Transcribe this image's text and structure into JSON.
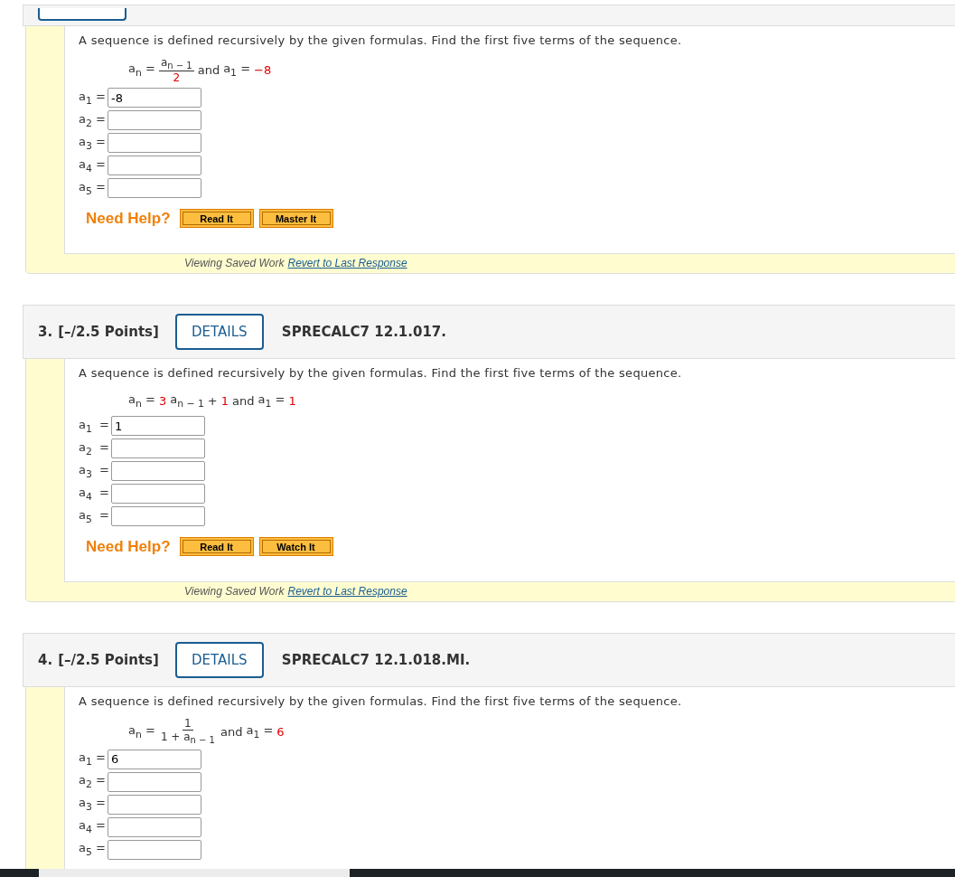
{
  "problems": [
    {
      "question": "A sequence is defined recursively by the given formulas. Find the first five terms of the sequence.",
      "formula": [
        {
          "text": "a$_{n}$ =",
          "red": false
        },
        {
          "kind": "fraction",
          "numerator": [
            {
              "text": "a$_{n − 1}$",
              "red": false
            }
          ],
          "denominator": [
            {
              "text": "2",
              "red": true
            }
          ]
        },
        {
          "text": "and",
          "red": false
        },
        {
          "text": "a$_{1}$ =",
          "red": false
        },
        {
          "text": "−8",
          "red": true
        }
      ],
      "answers": [
        {
          "label": "a$_{1}$ =",
          "value": "-8"
        },
        {
          "label": "a$_{2}$ ="
        },
        {
          "label": "a$_{3}$ ="
        },
        {
          "label": "a$_{4}$ ="
        },
        {
          "label": "a$_{5}$ ="
        }
      ],
      "help": "Need Help?",
      "buttons": [
        "Read It",
        "Master It"
      ],
      "saved_note": "Viewing Saved Work",
      "revert_link": "Revert to Last Response"
    },
    {
      "number": "3.",
      "points": "[–/2.5 Points]",
      "details": "DETAILS",
      "code": "SPRECALC7 12.1.017.",
      "question": "A sequence is defined recursively by the given formulas. Find the first five terms of the sequence.",
      "formula": [
        {
          "text": "a$_{n}$ =",
          "red": false
        },
        {
          "text": "3",
          "red": true
        },
        {
          "text": "a$_{n − 1}$",
          "red": false
        },
        {
          "text": "+",
          "red": false
        },
        {
          "text": "1",
          "red": true
        },
        {
          "text": "and",
          "red": false
        },
        {
          "text": "a$_{1}$ =",
          "red": false
        },
        {
          "text": "1",
          "red": true
        }
      ],
      "answers": [
        {
          "label": "a$_{1}$  =",
          "value": "1"
        },
        {
          "label": "a$_{2}$  ="
        },
        {
          "label": "a$_{3}$  ="
        },
        {
          "label": "a$_{4}$  ="
        },
        {
          "label": "a$_{5}$  ="
        }
      ],
      "help": "Need Help?",
      "buttons": [
        "Read It",
        "Watch It"
      ],
      "saved_note": "Viewing Saved Work",
      "revert_link": "Revert to Last Response"
    },
    {
      "number": "4.",
      "points": "[–/2.5 Points]",
      "details": "DETAILS",
      "code": "SPRECALC7 12.1.018.MI.",
      "question": "A sequence is defined recursively by the given formulas. Find the first five terms of the sequence.",
      "formula": [
        {
          "text": "a$_{n}$ =",
          "red": false
        },
        {
          "kind": "fraction",
          "numerator": [
            {
              "text": "1",
              "red": false
            }
          ],
          "denominator": [
            {
              "text": "1 + a$_{n − 1}$",
              "red": false
            }
          ]
        },
        {
          "text": "and",
          "red": false
        },
        {
          "text": "a$_{1}$ =",
          "red": false
        },
        {
          "text": "6",
          "red": true
        }
      ],
      "answers": [
        {
          "label": "a$_{1}$ =",
          "value": "6"
        },
        {
          "label": "a$_{2}$ ="
        },
        {
          "label": "a$_{3}$ ="
        },
        {
          "label": "a$_{4}$ ="
        },
        {
          "label": "a$_{5}$ ="
        }
      ]
    }
  ]
}
